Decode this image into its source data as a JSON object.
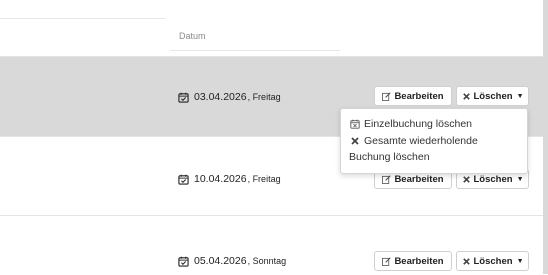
{
  "table": {
    "column_datum": "Datum",
    "rows": [
      {
        "date": "03.04.2026",
        "weekday": ", Freitag"
      },
      {
        "date": "10.04.2026",
        "weekday": ", Freitag"
      },
      {
        "date": "05.04.2026",
        "weekday": ", Sonntag"
      }
    ]
  },
  "actions": {
    "edit_label": "Bearbeiten",
    "delete_label": "Löschen"
  },
  "delete_menu": {
    "single_label": "Einzelbuchung löschen",
    "all_label_line1": "Gesamte wiederholende",
    "all_label_line2": "Buchung löschen"
  }
}
